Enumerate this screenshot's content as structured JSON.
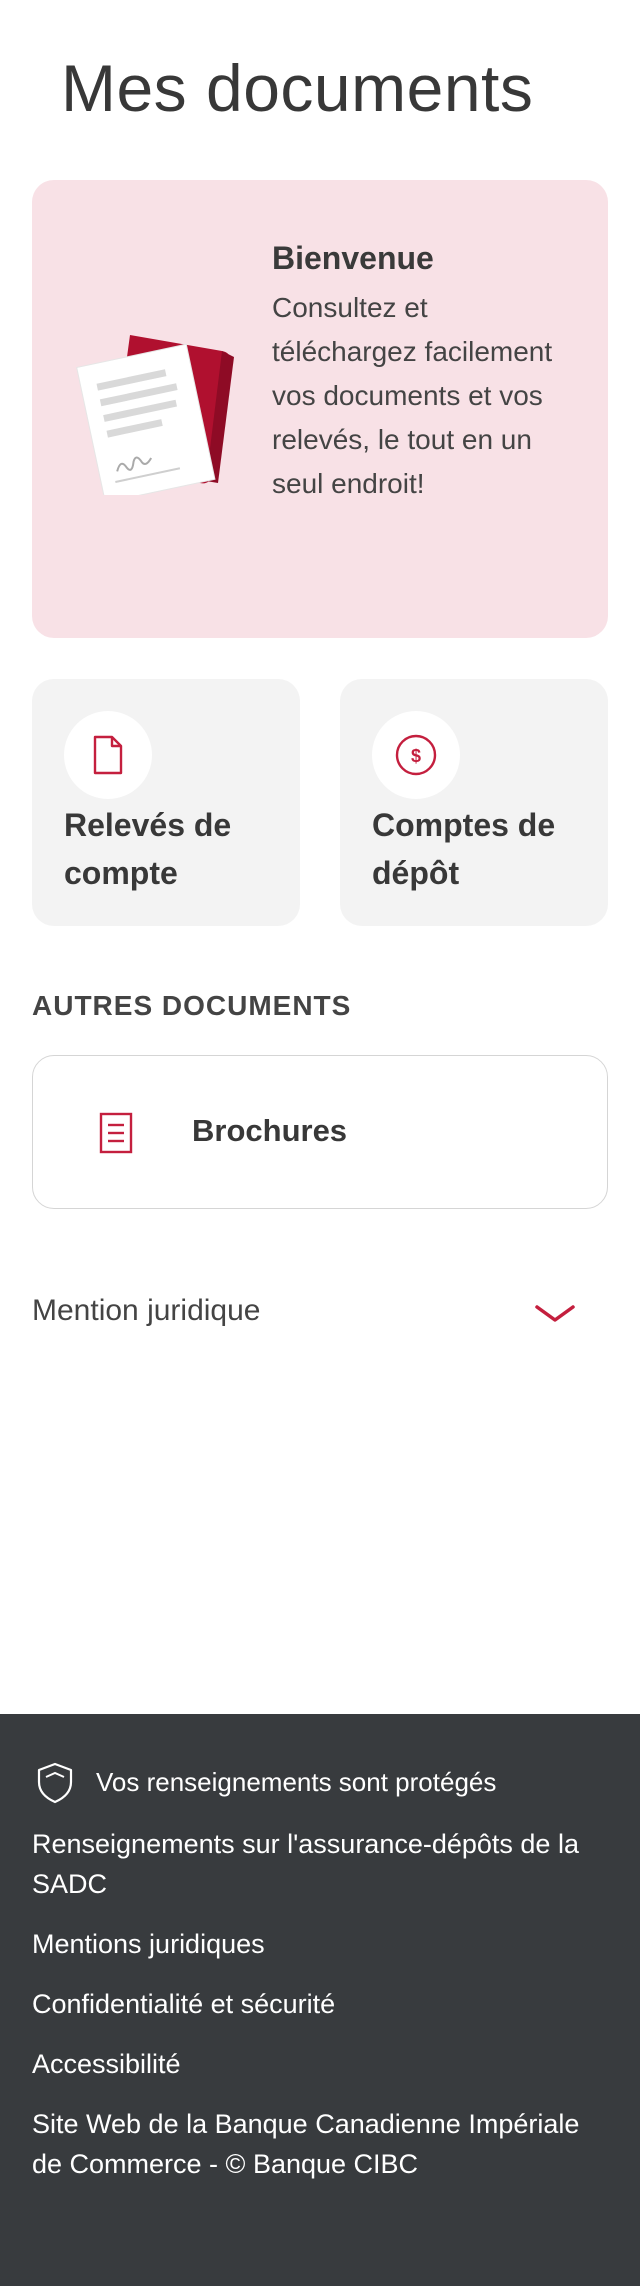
{
  "page": {
    "title": "Mes documents"
  },
  "welcome": {
    "title": "Bienvenue",
    "text": "Consultez et téléchargez facilement vos documents et vos relevés, le tout en un seul endroit!",
    "illustration_icon": "documents-folder-illustration"
  },
  "tiles": [
    {
      "label": "Relevés de compte",
      "icon": "document-icon"
    },
    {
      "label": "Comptes de dépôt",
      "icon": "dollar-circle-icon"
    }
  ],
  "other_documents": {
    "heading": "AUTRES DOCUMENTS",
    "items": [
      {
        "label": "Brochures",
        "icon": "brochure-icon"
      }
    ]
  },
  "legal": {
    "label": "Mention juridique",
    "icon": "chevron-down-icon"
  },
  "footer": {
    "protected_text": "Vos renseignements sont protégés",
    "links": [
      "Renseignements sur l'assurance-dépôts de la SADC",
      "Mentions juridiques",
      "Confidentialité et sécurité",
      "Accessibilité",
      "Site Web de la Banque Canadienne Impériale de Commerce - © Banque CIBC"
    ]
  },
  "colors": {
    "accent": "#c41f3e",
    "welcome_bg": "#f8e1e6",
    "tile_bg": "#f3f3f3",
    "footer_bg": "#383b3e"
  }
}
